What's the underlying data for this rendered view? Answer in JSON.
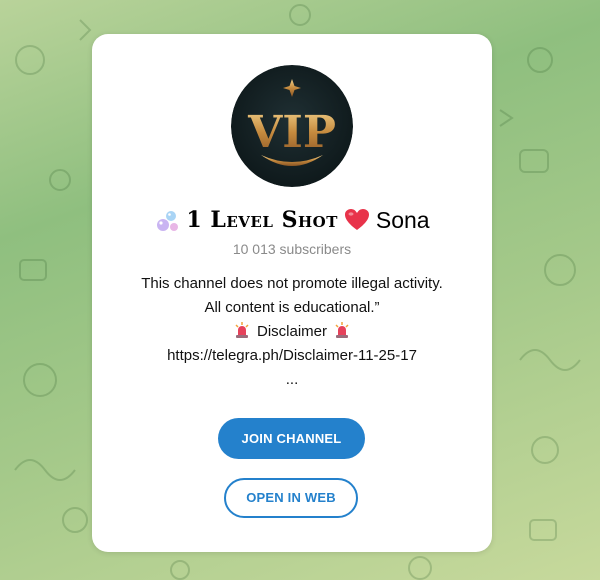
{
  "channel": {
    "avatar_text": "VIP",
    "title_icon_left": "bubbles-icon",
    "title_main": "1 Level Shot",
    "title_icon_right": "heart-icon",
    "title_name": "Sona",
    "subscribers": "10 013 subscribers"
  },
  "description": {
    "line1": "This channel does not promote illegal activity.",
    "line2": "All content is educational.”",
    "disclaimer": "Disclaimer",
    "link": "https://telegra.ph/Disclaimer-11-25-17",
    "more": "..."
  },
  "buttons": {
    "join": "JOIN CHANNEL",
    "open_web": "OPEN IN WEB"
  },
  "colors": {
    "accent": "#2481cc",
    "heart": "#e8334a",
    "subtitle": "#8a8a8a"
  }
}
